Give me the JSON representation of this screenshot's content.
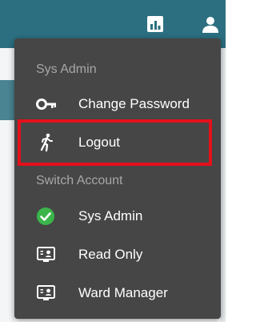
{
  "colors": {
    "topbar": "#2b6f80",
    "menu_bg": "#464646",
    "section_text": "#a7a7a7",
    "item_text": "#ffffff",
    "highlight": "#e5101b",
    "check_green": "#3bb54a"
  },
  "header": {
    "icons": [
      "bar-chart-icon",
      "user-icon"
    ]
  },
  "menu": {
    "sections": [
      {
        "title": "Sys Admin",
        "items": [
          {
            "label": "Change Password",
            "icon": "key-icon"
          },
          {
            "label": "Logout",
            "icon": "running-person-icon",
            "highlighted": true
          }
        ]
      },
      {
        "title": "Switch Account",
        "items": [
          {
            "label": "Sys Admin",
            "icon": "check-circle-icon",
            "selected": true
          },
          {
            "label": "Read Only",
            "icon": "account-card-icon"
          },
          {
            "label": "Ward Manager",
            "icon": "account-card-icon"
          }
        ]
      }
    ]
  }
}
